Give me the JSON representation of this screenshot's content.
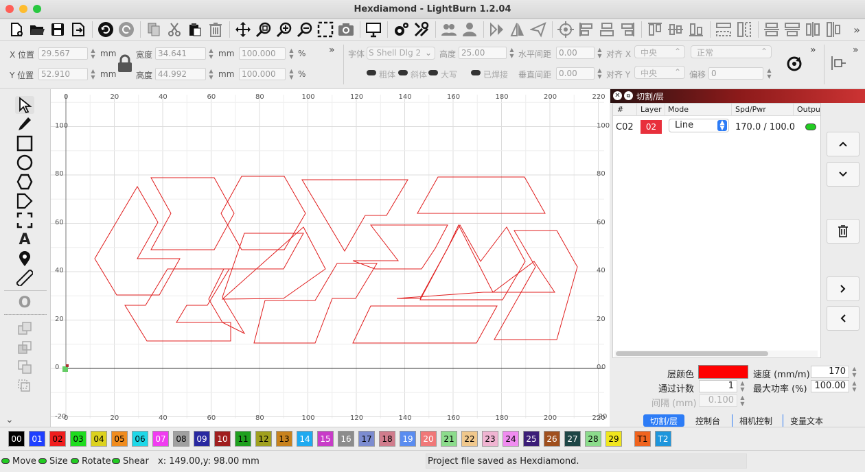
{
  "window": {
    "title": "Hexdiamond - LightBurn 1.2.04",
    "traffic_colors": [
      "#ff5f57",
      "#febc2e",
      "#28c840"
    ]
  },
  "toolbar": {
    "icons": [
      "new-file-icon",
      "open-folder-icon",
      "save-icon",
      "save-as-icon",
      "undo-icon",
      "redo-icon",
      "copy-icon",
      "cut-icon",
      "paste-icon",
      "delete-icon",
      "move-icon",
      "zoom-fit-icon",
      "zoom-in-icon",
      "zoom-out-icon",
      "frame-select-icon",
      "camera-icon",
      "monitor-icon",
      "settings-icon",
      "tools-icon",
      "group-icon",
      "user-icon",
      "mirror-h-icon",
      "mirror-v-icon",
      "send-icon",
      "target-icon",
      "align-left-icon",
      "align-center-icon",
      "align-right-icon",
      "align-top-icon",
      "align-middle-icon",
      "align-bottom-icon",
      "dist-h-icon",
      "dist-v-icon",
      "dist-1-icon",
      "dist-2-icon",
      "dist-3-icon",
      "dist-4-icon",
      "more-icon"
    ]
  },
  "props": {
    "x_label": "X 位置",
    "x_value": "29.567",
    "y_label": "Y 位置",
    "y_value": "52.910",
    "unit": "mm",
    "w_label": "宽度",
    "w_value": "34.641",
    "h_label": "高度",
    "h_value": "44.992",
    "scale_w": "100.000",
    "scale_h": "100.000",
    "percent": "%",
    "more": "»",
    "font_label": "字体",
    "font_value": "S Shell Dlg 2",
    "text_height_label": "高度",
    "text_height_value": "25.00",
    "hspace_label": "水平间距",
    "hspace_value": "0.00",
    "vspace_label": "垂直间距",
    "vspace_value": "0.00",
    "alignx_label": "对齐 X",
    "alignx_value": "中央",
    "aligny_label": "对齐 Y",
    "aligny_value": "中央",
    "style_value": "正常",
    "offset_label": "偏移",
    "offset_value": "0",
    "bold": "粗体",
    "italic": "斜体",
    "upper": "大写",
    "welded": "已焊接"
  },
  "rulers": {
    "x_ticks": [
      "0",
      "20",
      "40",
      "60",
      "80",
      "100",
      "120",
      "140",
      "160",
      "180",
      "200",
      "220"
    ],
    "y_ticks": [
      "100",
      "80",
      "60",
      "40",
      "20",
      "0"
    ],
    "bottom_first": "-20",
    "right_end": "0"
  },
  "layers_panel": {
    "title": "切割/层",
    "columns": [
      "#",
      "Layer",
      "Mode",
      "Spd/Pwr",
      "Outpu"
    ],
    "rows": [
      {
        "num": "C02",
        "layer": "02",
        "layer_color": "#e8303c",
        "mode": "Line",
        "spdpwr": "170.0 / 100.0"
      }
    ],
    "color_label": "层颜色",
    "layer_color": "#ff0000",
    "speed_label": "速度 (mm/m)",
    "speed_value": "170",
    "passes_label": "通过计数",
    "passes_value": "1",
    "power_label": "最大功率 (%)",
    "power_value": "100.00",
    "interval_label": "间隔 (mm)",
    "interval_value": "0.100"
  },
  "tabs": [
    "切割/层",
    "控制台",
    "相机控制",
    "变量文本"
  ],
  "palette": [
    {
      "label": "00",
      "color": "#000000",
      "fg": "#ffffff"
    },
    {
      "label": "01",
      "color": "#1f3fff",
      "fg": "#ffffff"
    },
    {
      "label": "02",
      "color": "#f01e1e",
      "fg": "#000000"
    },
    {
      "label": "03",
      "color": "#1edc1e",
      "fg": "#000000"
    },
    {
      "label": "04",
      "color": "#dcd21e",
      "fg": "#000000"
    },
    {
      "label": "05",
      "color": "#f08c1e",
      "fg": "#000000"
    },
    {
      "label": "06",
      "color": "#1ed8e8",
      "fg": "#000000"
    },
    {
      "label": "07",
      "color": "#f03cf0",
      "fg": "#ffffff"
    },
    {
      "label": "08",
      "color": "#a0a0a0",
      "fg": "#000000"
    },
    {
      "label": "09",
      "color": "#2828a0",
      "fg": "#ffffff"
    },
    {
      "label": "10",
      "color": "#a01e1e",
      "fg": "#ffffff"
    },
    {
      "label": "11",
      "color": "#1ea01e",
      "fg": "#000000"
    },
    {
      "label": "12",
      "color": "#a0a01e",
      "fg": "#000000"
    },
    {
      "label": "13",
      "color": "#c8821e",
      "fg": "#000000"
    },
    {
      "label": "14",
      "color": "#1eaaf0",
      "fg": "#ffffff"
    },
    {
      "label": "15",
      "color": "#c83cc8",
      "fg": "#ffffff"
    },
    {
      "label": "16",
      "color": "#8c8c8c",
      "fg": "#ffffff"
    },
    {
      "label": "17",
      "color": "#7c8cd0",
      "fg": "#000000"
    },
    {
      "label": "18",
      "color": "#d07c8c",
      "fg": "#000000"
    },
    {
      "label": "19",
      "color": "#5a8cf0",
      "fg": "#ffffff"
    },
    {
      "label": "20",
      "color": "#f07878",
      "fg": "#ffffff"
    },
    {
      "label": "21",
      "color": "#8cdc8c",
      "fg": "#000000"
    },
    {
      "label": "22",
      "color": "#f0c88c",
      "fg": "#000000"
    },
    {
      "label": "23",
      "color": "#f0b4d2",
      "fg": "#000000"
    },
    {
      "label": "24",
      "color": "#f08cf0",
      "fg": "#000000"
    },
    {
      "label": "25",
      "color": "#3c1e78",
      "fg": "#ffffff"
    },
    {
      "label": "26",
      "color": "#a0501e",
      "fg": "#ffffff"
    },
    {
      "label": "27",
      "color": "#1e4646",
      "fg": "#ffffff"
    },
    {
      "label": "28",
      "color": "#8cdc8c",
      "fg": "#000000"
    },
    {
      "label": "29",
      "color": "#f0e61e",
      "fg": "#000000"
    },
    {
      "label": "T1",
      "color": "#f0641e",
      "fg": "#000000"
    },
    {
      "label": "T2",
      "color": "#1e96dc",
      "fg": "#ffffff"
    }
  ],
  "status": {
    "move": "Move",
    "size": "Size",
    "rotate": "Rotate",
    "shear": "Shear",
    "coords": "x: 149.00,y: 98.00 mm",
    "message": "Project file saved as Hexdiamond."
  }
}
